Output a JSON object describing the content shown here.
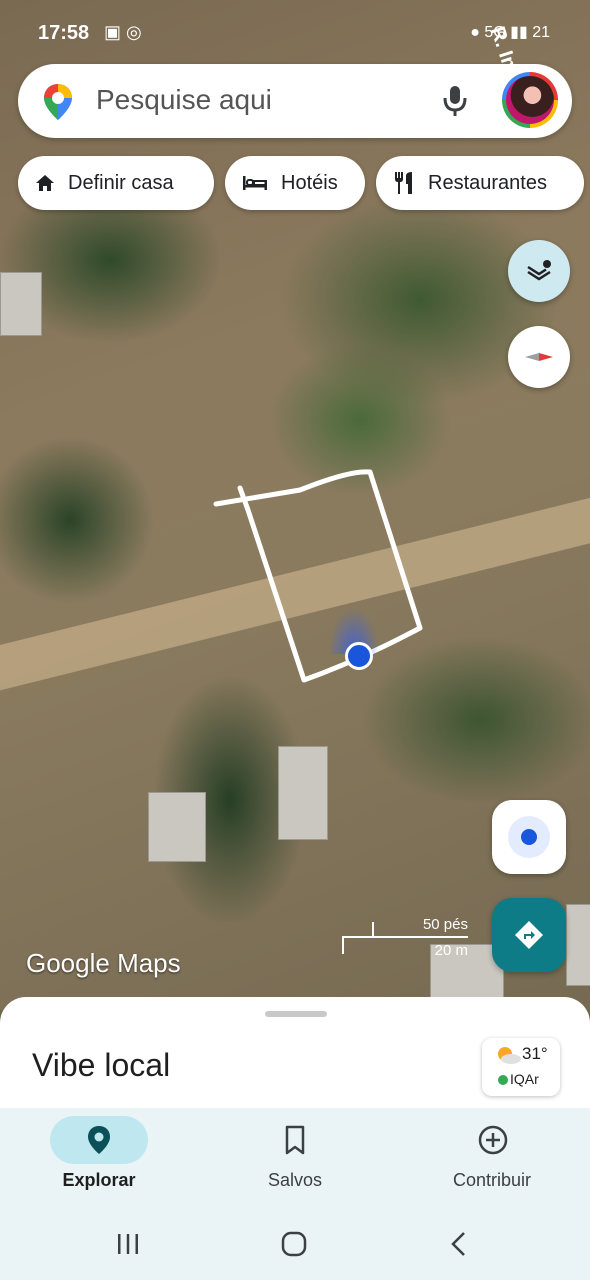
{
  "status_bar": {
    "time": "17:58",
    "left_icons": "▣ ◎",
    "right_icons": "● 5G ▮▮ 21"
  },
  "map": {
    "street_label": "R. Impera"
  },
  "search": {
    "placeholder": "Pesquise aqui"
  },
  "chips": [
    {
      "label": "Definir casa",
      "icon": "home-icon"
    },
    {
      "label": "Hotéis",
      "icon": "bed-icon"
    },
    {
      "label": "Restaurantes",
      "icon": "restaurant-icon"
    }
  ],
  "scale": {
    "imperial": "50 pés",
    "metric": "20 m"
  },
  "logo_text": "Google Maps",
  "sheet": {
    "title": "Vibe local"
  },
  "weather": {
    "temp": "31°",
    "air_quality": "IQAr"
  },
  "bottom_nav": [
    {
      "label": "Explorar",
      "icon": "explore-pin-icon",
      "active": true
    },
    {
      "label": "Salvos",
      "icon": "bookmark-icon",
      "active": false
    },
    {
      "label": "Contribuir",
      "icon": "add-circle-icon",
      "active": false
    }
  ],
  "colors": {
    "accent_teal": "#0e7c86",
    "location_blue": "#1a56db",
    "active_pill": "#bfe7f0"
  }
}
